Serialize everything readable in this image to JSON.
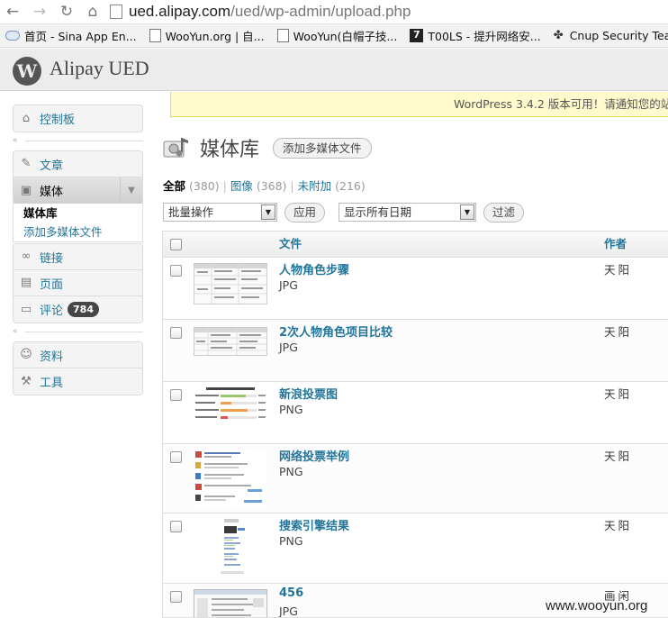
{
  "browser": {
    "url_host": "ued.alipay.com",
    "url_path": "/ued/wp-admin/upload.php",
    "bookmarks": [
      {
        "label": "首页 - Sina App En...",
        "icon": "cloud-icon"
      },
      {
        "label": "WooYun.org | 自...",
        "icon": "page-icon"
      },
      {
        "label": "WooYun(白帽子技...",
        "icon": "page-icon"
      },
      {
        "label": "T00LS - 提升网络安...",
        "icon": "seven-icon"
      },
      {
        "label": "Cnup Security Team",
        "icon": "cnup-icon"
      }
    ]
  },
  "header": {
    "site_name": "Alipay UED"
  },
  "sidebar": {
    "dashboard": "控制板",
    "posts": "文章",
    "media": "媒体",
    "media_sub": [
      "媒体库",
      "添加多媒体文件"
    ],
    "links": "链接",
    "pages": "页面",
    "comments": "评论",
    "comments_count": "784",
    "profile": "资料",
    "tools": "工具"
  },
  "notice": "WordPress 3.4.2 版本可用！请通知您的站",
  "page": {
    "title": "媒体库",
    "add_button": "添加多媒体文件"
  },
  "filters": {
    "all_label": "全部",
    "all_count": "(380)",
    "images_label": "图像",
    "images_count": "(368)",
    "unattached_label": "未附加",
    "unattached_count": "(216)",
    "separator": "|"
  },
  "actions": {
    "bulk_select": "批量操作",
    "apply_button": "应用",
    "date_select": "显示所有日期",
    "filter_button": "过滤"
  },
  "table": {
    "columns": {
      "file": "文件",
      "author": "作者"
    },
    "rows": [
      {
        "name": "人物角色步骤",
        "type": "JPG",
        "author": "天阳"
      },
      {
        "name": "2次人物角色项目比较",
        "type": "JPG",
        "author": "天阳"
      },
      {
        "name": "新浪投票图",
        "type": "PNG",
        "author": "天阳"
      },
      {
        "name": "网络投票举例",
        "type": "PNG",
        "author": "天阳"
      },
      {
        "name": "搜索引擎结果",
        "type": "PNG",
        "author": "天阳"
      },
      {
        "name": "456",
        "type": "JPG",
        "author": "画闲"
      }
    ]
  },
  "watermark": "www.wooyun.org",
  "colors": {
    "link": "#21759b",
    "notice_bg": "#fffbcc",
    "badge_bg": "#464646"
  }
}
